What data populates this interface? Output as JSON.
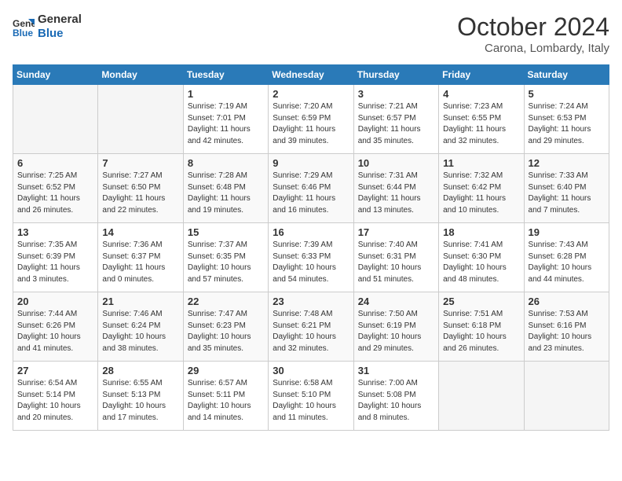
{
  "logo": {
    "line1": "General",
    "line2": "Blue"
  },
  "title": "October 2024",
  "subtitle": "Carona, Lombardy, Italy",
  "days_header": [
    "Sunday",
    "Monday",
    "Tuesday",
    "Wednesday",
    "Thursday",
    "Friday",
    "Saturday"
  ],
  "weeks": [
    [
      {
        "num": "",
        "empty": true
      },
      {
        "num": "",
        "empty": true
      },
      {
        "num": "1",
        "info": "Sunrise: 7:19 AM\nSunset: 7:01 PM\nDaylight: 11 hours and 42 minutes."
      },
      {
        "num": "2",
        "info": "Sunrise: 7:20 AM\nSunset: 6:59 PM\nDaylight: 11 hours and 39 minutes."
      },
      {
        "num": "3",
        "info": "Sunrise: 7:21 AM\nSunset: 6:57 PM\nDaylight: 11 hours and 35 minutes."
      },
      {
        "num": "4",
        "info": "Sunrise: 7:23 AM\nSunset: 6:55 PM\nDaylight: 11 hours and 32 minutes."
      },
      {
        "num": "5",
        "info": "Sunrise: 7:24 AM\nSunset: 6:53 PM\nDaylight: 11 hours and 29 minutes."
      }
    ],
    [
      {
        "num": "6",
        "info": "Sunrise: 7:25 AM\nSunset: 6:52 PM\nDaylight: 11 hours and 26 minutes."
      },
      {
        "num": "7",
        "info": "Sunrise: 7:27 AM\nSunset: 6:50 PM\nDaylight: 11 hours and 22 minutes."
      },
      {
        "num": "8",
        "info": "Sunrise: 7:28 AM\nSunset: 6:48 PM\nDaylight: 11 hours and 19 minutes."
      },
      {
        "num": "9",
        "info": "Sunrise: 7:29 AM\nSunset: 6:46 PM\nDaylight: 11 hours and 16 minutes."
      },
      {
        "num": "10",
        "info": "Sunrise: 7:31 AM\nSunset: 6:44 PM\nDaylight: 11 hours and 13 minutes."
      },
      {
        "num": "11",
        "info": "Sunrise: 7:32 AM\nSunset: 6:42 PM\nDaylight: 11 hours and 10 minutes."
      },
      {
        "num": "12",
        "info": "Sunrise: 7:33 AM\nSunset: 6:40 PM\nDaylight: 11 hours and 7 minutes."
      }
    ],
    [
      {
        "num": "13",
        "info": "Sunrise: 7:35 AM\nSunset: 6:39 PM\nDaylight: 11 hours and 3 minutes."
      },
      {
        "num": "14",
        "info": "Sunrise: 7:36 AM\nSunset: 6:37 PM\nDaylight: 11 hours and 0 minutes."
      },
      {
        "num": "15",
        "info": "Sunrise: 7:37 AM\nSunset: 6:35 PM\nDaylight: 10 hours and 57 minutes."
      },
      {
        "num": "16",
        "info": "Sunrise: 7:39 AM\nSunset: 6:33 PM\nDaylight: 10 hours and 54 minutes."
      },
      {
        "num": "17",
        "info": "Sunrise: 7:40 AM\nSunset: 6:31 PM\nDaylight: 10 hours and 51 minutes."
      },
      {
        "num": "18",
        "info": "Sunrise: 7:41 AM\nSunset: 6:30 PM\nDaylight: 10 hours and 48 minutes."
      },
      {
        "num": "19",
        "info": "Sunrise: 7:43 AM\nSunset: 6:28 PM\nDaylight: 10 hours and 44 minutes."
      }
    ],
    [
      {
        "num": "20",
        "info": "Sunrise: 7:44 AM\nSunset: 6:26 PM\nDaylight: 10 hours and 41 minutes."
      },
      {
        "num": "21",
        "info": "Sunrise: 7:46 AM\nSunset: 6:24 PM\nDaylight: 10 hours and 38 minutes."
      },
      {
        "num": "22",
        "info": "Sunrise: 7:47 AM\nSunset: 6:23 PM\nDaylight: 10 hours and 35 minutes."
      },
      {
        "num": "23",
        "info": "Sunrise: 7:48 AM\nSunset: 6:21 PM\nDaylight: 10 hours and 32 minutes."
      },
      {
        "num": "24",
        "info": "Sunrise: 7:50 AM\nSunset: 6:19 PM\nDaylight: 10 hours and 29 minutes."
      },
      {
        "num": "25",
        "info": "Sunrise: 7:51 AM\nSunset: 6:18 PM\nDaylight: 10 hours and 26 minutes."
      },
      {
        "num": "26",
        "info": "Sunrise: 7:53 AM\nSunset: 6:16 PM\nDaylight: 10 hours and 23 minutes."
      }
    ],
    [
      {
        "num": "27",
        "info": "Sunrise: 6:54 AM\nSunset: 5:14 PM\nDaylight: 10 hours and 20 minutes."
      },
      {
        "num": "28",
        "info": "Sunrise: 6:55 AM\nSunset: 5:13 PM\nDaylight: 10 hours and 17 minutes."
      },
      {
        "num": "29",
        "info": "Sunrise: 6:57 AM\nSunset: 5:11 PM\nDaylight: 10 hours and 14 minutes."
      },
      {
        "num": "30",
        "info": "Sunrise: 6:58 AM\nSunset: 5:10 PM\nDaylight: 10 hours and 11 minutes."
      },
      {
        "num": "31",
        "info": "Sunrise: 7:00 AM\nSunset: 5:08 PM\nDaylight: 10 hours and 8 minutes."
      },
      {
        "num": "",
        "empty": true
      },
      {
        "num": "",
        "empty": true
      }
    ]
  ]
}
